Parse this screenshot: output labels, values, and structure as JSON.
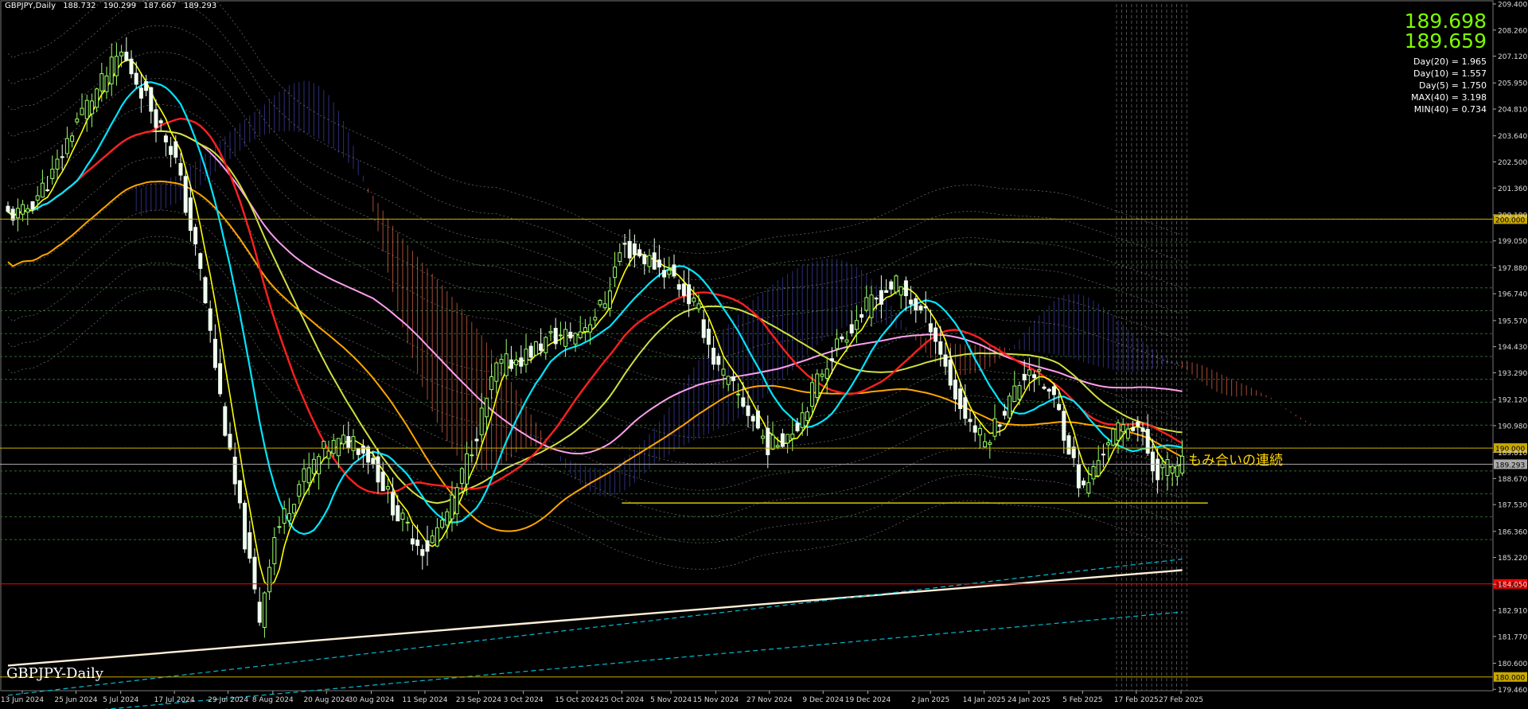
{
  "header": {
    "symbol_tf": "GBPJPY,Daily",
    "open": "188.732",
    "high": "190.299",
    "low": "187.667",
    "close": "189.293"
  },
  "symbol_label": "GBPJPY-Daily",
  "info": {
    "bid": "189.698",
    "ask": "189.659",
    "stats": [
      "Day(20) = 1.965",
      "Day(10) = 1.557",
      "Day(5) = 1.750",
      "MAX(40) = 3.198",
      "MIN(40) = 0.734"
    ]
  },
  "annotation": "もみ合いの連続",
  "chart_data": {
    "type": "candlestick",
    "title": "GBPJPY-Daily",
    "ylim": [
      179.4,
      209.4
    ],
    "y_ticks": [
      "209.400",
      "208.260",
      "207.120",
      "205.950",
      "204.810",
      "203.640",
      "202.500",
      "201.360",
      "200.190",
      "199.050",
      "197.880",
      "196.740",
      "195.570",
      "194.430",
      "193.290",
      "192.120",
      "190.980",
      "189.810",
      "188.670",
      "187.530",
      "186.360",
      "185.220",
      "184.050",
      "182.910",
      "181.770",
      "180.600",
      "179.460"
    ],
    "x_labels": [
      "13 Jun 2024",
      "25 Jun 2024",
      "5 Jul 2024",
      "17 Jul 2024",
      "29 Jul 2024",
      "8 Aug 2024",
      "20 Aug 2024",
      "30 Aug 2024",
      "11 Sep 2024",
      "23 Sep 2024",
      "3 Oct 2024",
      "15 Oct 2024",
      "25 Oct 2024",
      "5 Nov 2024",
      "15 Nov 2024",
      "27 Nov 2024",
      "9 Dec 2024",
      "19 Dec 2024",
      "2 Jan 2025",
      "14 Jan 2025",
      "24 Jan 2025",
      "5 Feb 2025",
      "17 Feb 2025",
      "27 Feb 2025"
    ],
    "close_path": [
      {
        "x": "13 Jun 2024",
        "y": 200.2
      },
      {
        "x": "20 Jun 2024",
        "y": 202.0
      },
      {
        "x": "25 Jun 2024",
        "y": 204.3
      },
      {
        "x": "1 Jul 2024",
        "y": 206.0
      },
      {
        "x": "5 Jul 2024",
        "y": 207.3
      },
      {
        "x": "11 Jul 2024",
        "y": 205.2
      },
      {
        "x": "17 Jul 2024",
        "y": 202.8
      },
      {
        "x": "23 Jul 2024",
        "y": 197.5
      },
      {
        "x": "29 Jul 2024",
        "y": 190.0
      },
      {
        "x": "5 Aug 2024",
        "y": 182.5
      },
      {
        "x": "8 Aug 2024",
        "y": 186.0
      },
      {
        "x": "14 Aug 2024",
        "y": 188.5
      },
      {
        "x": "20 Aug 2024",
        "y": 190.0
      },
      {
        "x": "26 Aug 2024",
        "y": 190.4
      },
      {
        "x": "30 Aug 2024",
        "y": 189.5
      },
      {
        "x": "5 Sep 2024",
        "y": 187.0
      },
      {
        "x": "11 Sep 2024",
        "y": 185.5
      },
      {
        "x": "17 Sep 2024",
        "y": 187.5
      },
      {
        "x": "23 Sep 2024",
        "y": 191.0
      },
      {
        "x": "27 Sep 2024",
        "y": 193.5
      },
      {
        "x": "3 Oct 2024",
        "y": 194.0
      },
      {
        "x": "9 Oct 2024",
        "y": 194.8
      },
      {
        "x": "15 Oct 2024",
        "y": 195.0
      },
      {
        "x": "21 Oct 2024",
        "y": 196.3
      },
      {
        "x": "25 Oct 2024",
        "y": 198.8
      },
      {
        "x": "31 Oct 2024",
        "y": 198.2
      },
      {
        "x": "5 Nov 2024",
        "y": 197.6
      },
      {
        "x": "11 Nov 2024",
        "y": 196.0
      },
      {
        "x": "15 Nov 2024",
        "y": 193.6
      },
      {
        "x": "21 Nov 2024",
        "y": 192.0
      },
      {
        "x": "27 Nov 2024",
        "y": 190.0
      },
      {
        "x": "3 Dec 2024",
        "y": 191.0
      },
      {
        "x": "9 Dec 2024",
        "y": 193.5
      },
      {
        "x": "13 Dec 2024",
        "y": 194.8
      },
      {
        "x": "19 Dec 2024",
        "y": 196.2
      },
      {
        "x": "25 Dec 2024",
        "y": 197.2
      },
      {
        "x": "2 Jan 2025",
        "y": 195.5
      },
      {
        "x": "8 Jan 2025",
        "y": 192.0
      },
      {
        "x": "14 Jan 2025",
        "y": 190.2
      },
      {
        "x": "20 Jan 2025",
        "y": 192.2
      },
      {
        "x": "24 Jan 2025",
        "y": 193.6
      },
      {
        "x": "30 Jan 2025",
        "y": 192.0
      },
      {
        "x": "5 Feb 2025",
        "y": 188.0
      },
      {
        "x": "11 Feb 2025",
        "y": 190.5
      },
      {
        "x": "17 Feb 2025",
        "y": 191.2
      },
      {
        "x": "21 Feb 2025",
        "y": 189.0
      },
      {
        "x": "27 Feb 2025",
        "y": 189.3
      }
    ],
    "horizontal_levels": [
      {
        "price": 184.065,
        "label": "184.065",
        "color": "#ff0000"
      },
      {
        "price": 189.293,
        "label": "189.293",
        "color": "#aaaaaa"
      },
      {
        "price": 190.0,
        "label": "190.000",
        "color": "#c8a800"
      },
      {
        "price": 200.0,
        "label": "200.000",
        "color": "#c8a800"
      },
      {
        "price": 180.0,
        "label": "180.000",
        "color": "#c8a800"
      }
    ],
    "support_line": {
      "from": "25 Oct 2024",
      "to": "5 Mar 2025",
      "price": 187.6,
      "color": "#d4c800"
    },
    "colors": {
      "up": "#9aff6a",
      "down": "#f0fff0",
      "ma_fast": "#ffff00",
      "ma_20": "#00e5ff",
      "ma_50": "#ff2020",
      "ma_100": "#d0e040",
      "ma_200": "#ffa500",
      "ma_pink": "#ff9ff0",
      "cloud_bull": "#3a3a9a",
      "cloud_bear": "#d06040",
      "long_ma": "#fff0d8"
    }
  }
}
